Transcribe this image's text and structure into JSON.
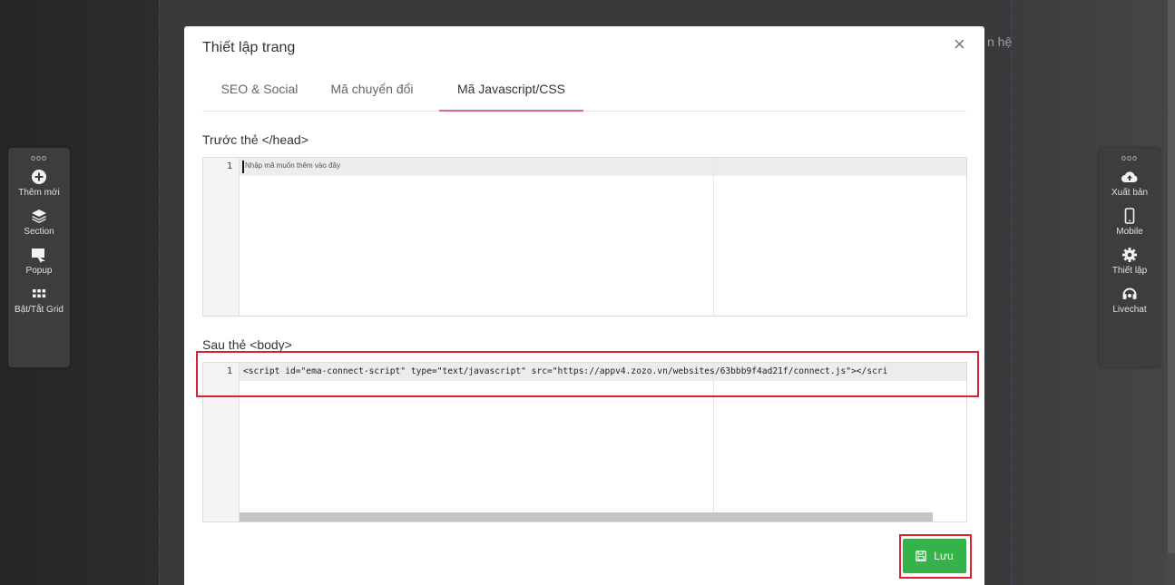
{
  "background": {
    "right_partial_text": "n hệ"
  },
  "left_toolbar": {
    "handle": "ooo",
    "items": [
      {
        "label": "Thêm mới",
        "icon": "plus-circle-icon"
      },
      {
        "label": "Section",
        "icon": "layers-icon"
      },
      {
        "label": "Popup",
        "icon": "popup-icon"
      },
      {
        "label": "Bật/Tắt Grid",
        "icon": "grid-icon"
      }
    ]
  },
  "right_toolbar": {
    "handle": "ooo",
    "items": [
      {
        "label": "Xuất bản",
        "icon": "cloud-upload-icon"
      },
      {
        "label": "Mobile",
        "icon": "mobile-icon"
      },
      {
        "label": "Thiết lập",
        "icon": "gear-icon"
      },
      {
        "label": "Livechat",
        "icon": "headset-icon"
      }
    ]
  },
  "modal": {
    "title": "Thiết lập trang",
    "close_label": "×",
    "tabs": [
      {
        "label": "SEO & Social",
        "active": false
      },
      {
        "label": "Mã chuyển đổi",
        "active": false
      },
      {
        "label": "Mã Javascript/CSS",
        "active": true
      }
    ],
    "head_section": {
      "label": "Trước thẻ </head>",
      "line_number": "1",
      "placeholder": "Nhập mã muốn thêm vào đây"
    },
    "body_section": {
      "label": "Sau thẻ <body>",
      "line_number": "1",
      "code": "<script id=\"ema-connect-script\" type=\"text/javascript\" src=\"https://appv4.zozo.vn/websites/63bbb9f4ad21f/connect.js\"></scri"
    },
    "save_button": {
      "label": "Lưu",
      "icon": "save-icon"
    }
  },
  "colors": {
    "accent_tab": "#e0619a",
    "save_green": "#35b34a",
    "highlight_red": "#d9232e"
  }
}
